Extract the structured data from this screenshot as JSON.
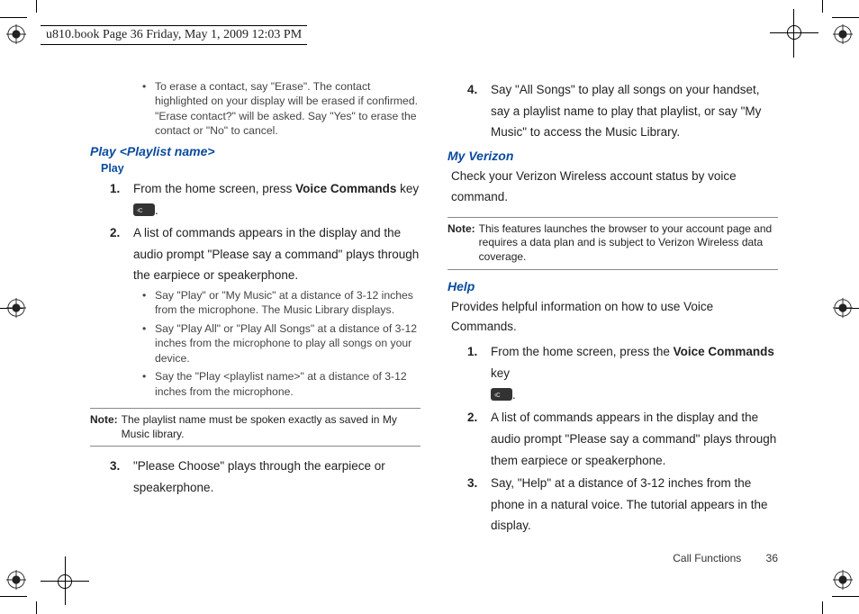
{
  "header": "u810.book  Page 36  Friday, May 1, 2009  12:03 PM",
  "left": {
    "top_bullet": "To erase a contact, say \"Erase\". The contact highlighted on your display will be erased if confirmed. \"Erase contact?\" will be asked. Say \"Yes\" to erase the contact or \"No\" to cancel.",
    "h_play_playlist": "Play <Playlist name>",
    "h_play": "Play",
    "step1_a": "From the home screen, press ",
    "step1_bold": "Voice Commands",
    "step1_b": " key ",
    "step2": "A list of commands appears in the display and the audio prompt \"Please say a command\" plays through the earpiece or speakerphone.",
    "sub_b1": "Say \"Play\" or \"My Music\" at a distance of 3-12 inches from the microphone. The Music Library displays.",
    "sub_b2": "Say \"Play All\" or \"Play All Songs\" at a distance of 3-12 inches from the microphone to play all songs on your device.",
    "sub_b3": "Say the \"Play <playlist name>\" at a distance of 3-12 inches from the microphone.",
    "note_label": "Note:",
    "note_body": "The playlist name must be spoken exactly as saved in My Music library.",
    "step3": "\"Please Choose\" plays through the earpiece or speakerphone."
  },
  "right": {
    "step4": "Say \"All Songs\" to play all songs on your handset, say a playlist name to play that playlist, or say \"My Music\" to access the Music Library.",
    "h_myverizon": "My Verizon",
    "mv_body": "Check your Verizon Wireless account status by voice command.",
    "note_label": "Note:",
    "note_body": "This features launches the browser to your account page and requires a data plan and is subject to Verizon Wireless data coverage.",
    "h_help": "Help",
    "help_body": "Provides helpful information on how to use Voice Commands.",
    "h_step1_a": "From the home screen, press the ",
    "h_step1_bold": "Voice Commands",
    "h_step1_b": " key ",
    "h_step2": "A list of commands appears in the display and the audio prompt \"Please say a command\" plays through them earpiece or speakerphone.",
    "h_step3": "Say, \"Help\" at a distance of 3-12 inches from the phone in a natural voice. The tutorial appears in the display."
  },
  "footer": {
    "section": "Call Functions",
    "page": "36"
  },
  "nums": {
    "n1": "1.",
    "n2": "2.",
    "n3": "3.",
    "n4": "4."
  }
}
